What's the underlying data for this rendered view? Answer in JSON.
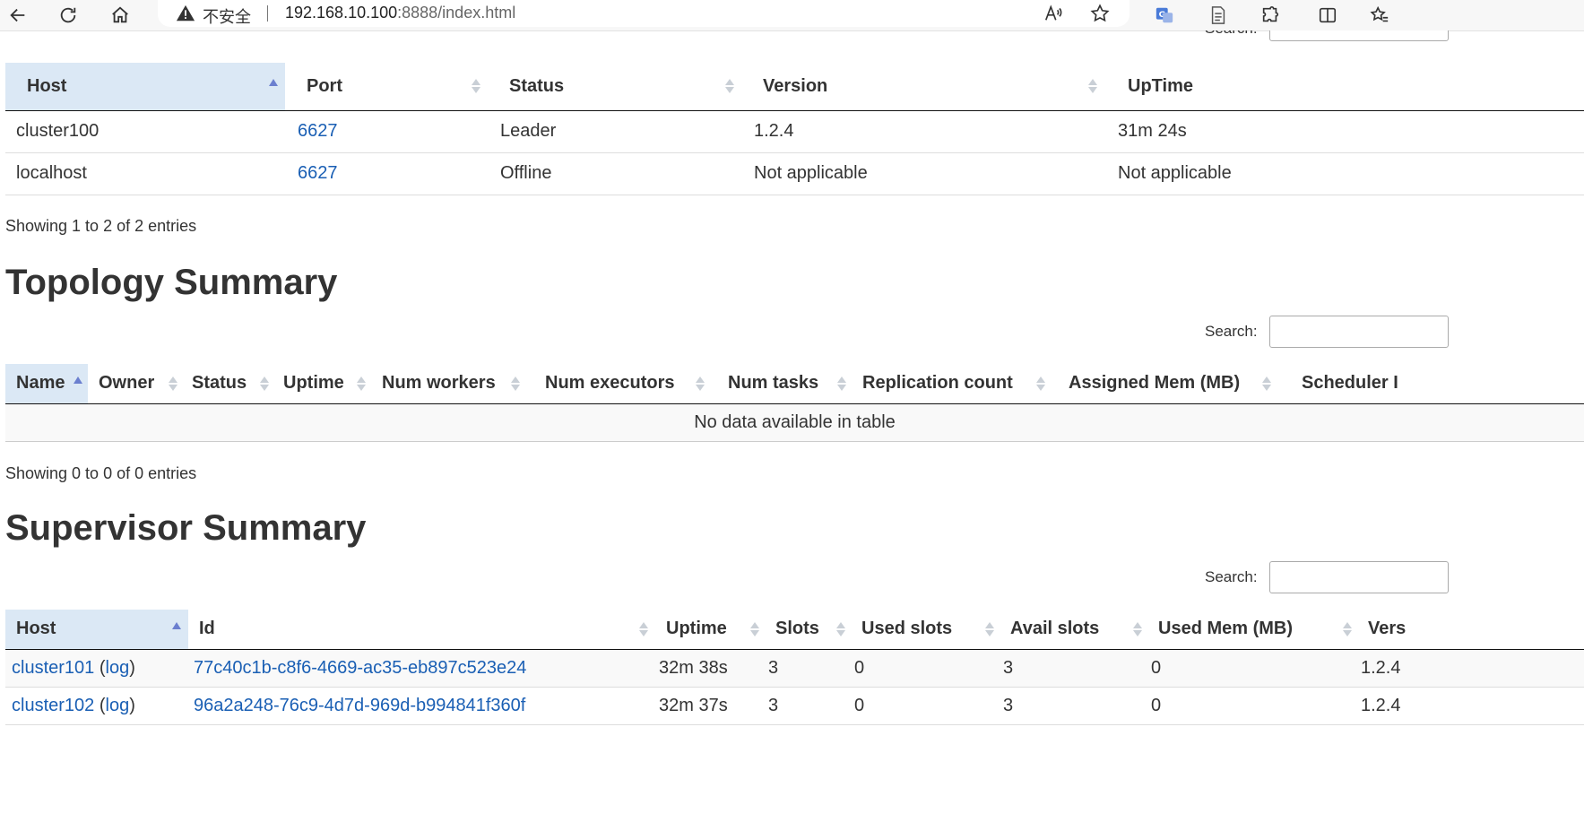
{
  "browser": {
    "insecure_label": "不安全",
    "url_host": "192.168.10.100",
    "url_rest": ":8888/index.html"
  },
  "nimbus": {
    "search_label": "Search:",
    "columns": [
      "Host",
      "Port",
      "Status",
      "Version",
      "UpTime"
    ],
    "rows": [
      {
        "host": "cluster100",
        "port": "6627",
        "status": "Leader",
        "version": "1.2.4",
        "uptime": "31m 24s"
      },
      {
        "host": "localhost",
        "port": "6627",
        "status": "Offline",
        "version": "Not applicable",
        "uptime": "Not applicable"
      }
    ],
    "info": "Showing 1 to 2 of 2 entries"
  },
  "topology": {
    "title": "Topology Summary",
    "search_label": "Search:",
    "columns": [
      "Name",
      "Owner",
      "Status",
      "Uptime",
      "Num workers",
      "Num executors",
      "Num tasks",
      "Replication count",
      "Assigned Mem (MB)",
      "Scheduler I"
    ],
    "empty": "No data available in table",
    "info": "Showing 0 to 0 of 0 entries"
  },
  "supervisor": {
    "title": "Supervisor Summary",
    "search_label": "Search:",
    "columns": [
      "Host",
      "Id",
      "Uptime",
      "Slots",
      "Used slots",
      "Avail slots",
      "Used Mem (MB)",
      "Vers"
    ],
    "log_label": "log",
    "rows": [
      {
        "host": "cluster101",
        "id": "77c40c1b-c8f6-4669-ac35-eb897c523e24",
        "uptime": "32m 38s",
        "slots": "3",
        "used_slots": "0",
        "avail_slots": "3",
        "used_mem": "0",
        "version": "1.2.4"
      },
      {
        "host": "cluster102",
        "id": "96a2a248-76c9-4d7d-969d-b994841f360f",
        "uptime": "32m 37s",
        "slots": "3",
        "used_slots": "0",
        "avail_slots": "3",
        "used_mem": "0",
        "version": "1.2.4"
      }
    ]
  }
}
